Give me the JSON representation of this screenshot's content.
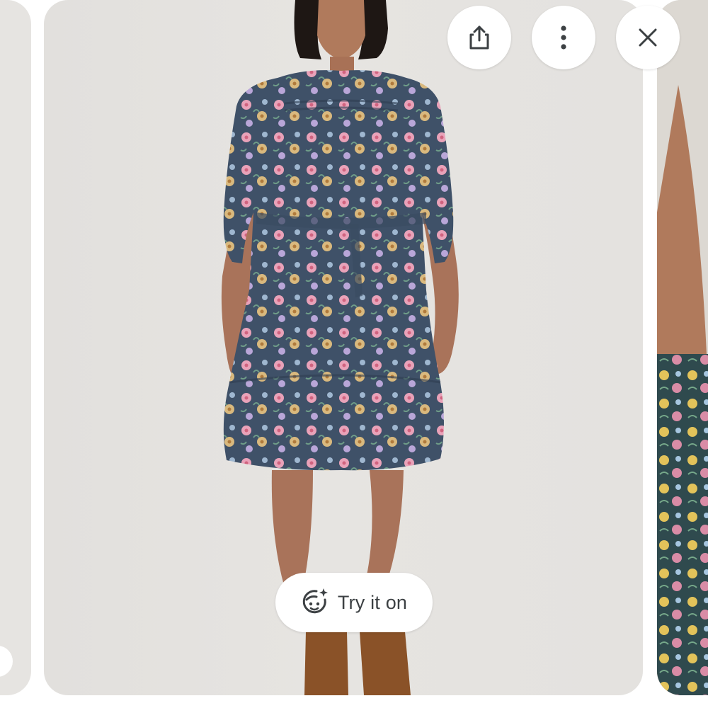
{
  "viewer": {
    "try_on_label": "Try it on"
  },
  "icons": {
    "share": "share-icon",
    "more": "more-vert-icon",
    "close": "close-icon",
    "try_on": "face-sparkle-icon"
  },
  "colors": {
    "button_bg": "#ffffff",
    "icon": "#3c4043",
    "card_bg": "#e6e4e1"
  }
}
